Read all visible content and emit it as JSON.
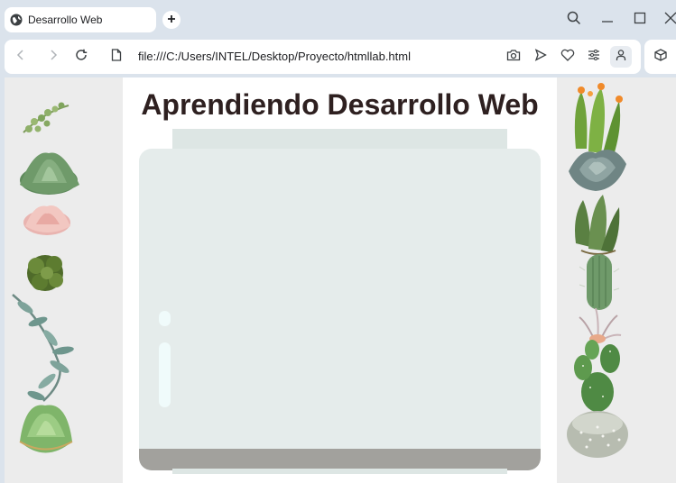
{
  "browser": {
    "tab_title": "Desarrollo Web",
    "url": "file:///C:/Users/INTEL/Desktop/Proyecto/htmllab.html"
  },
  "page": {
    "title": "Aprendiendo Desarrollo Web"
  },
  "colors": {
    "title": "#2e2020",
    "jar_glass": "#e5eceb",
    "jar_base": "#a2a19d",
    "side_bg": "#ececec"
  },
  "icons": {
    "left_plants": [
      "small-leaf-plant",
      "green-succulent",
      "pink-succulent",
      "dark-succulent",
      "eucalyptus-branch",
      "round-succulent"
    ],
    "right_plants": [
      "flowering-cactus",
      "grey-succulent",
      "spiky-succulent",
      "column-cactus",
      "air-plant",
      "prickly-pear-cactus",
      "round-white-cactus"
    ]
  }
}
